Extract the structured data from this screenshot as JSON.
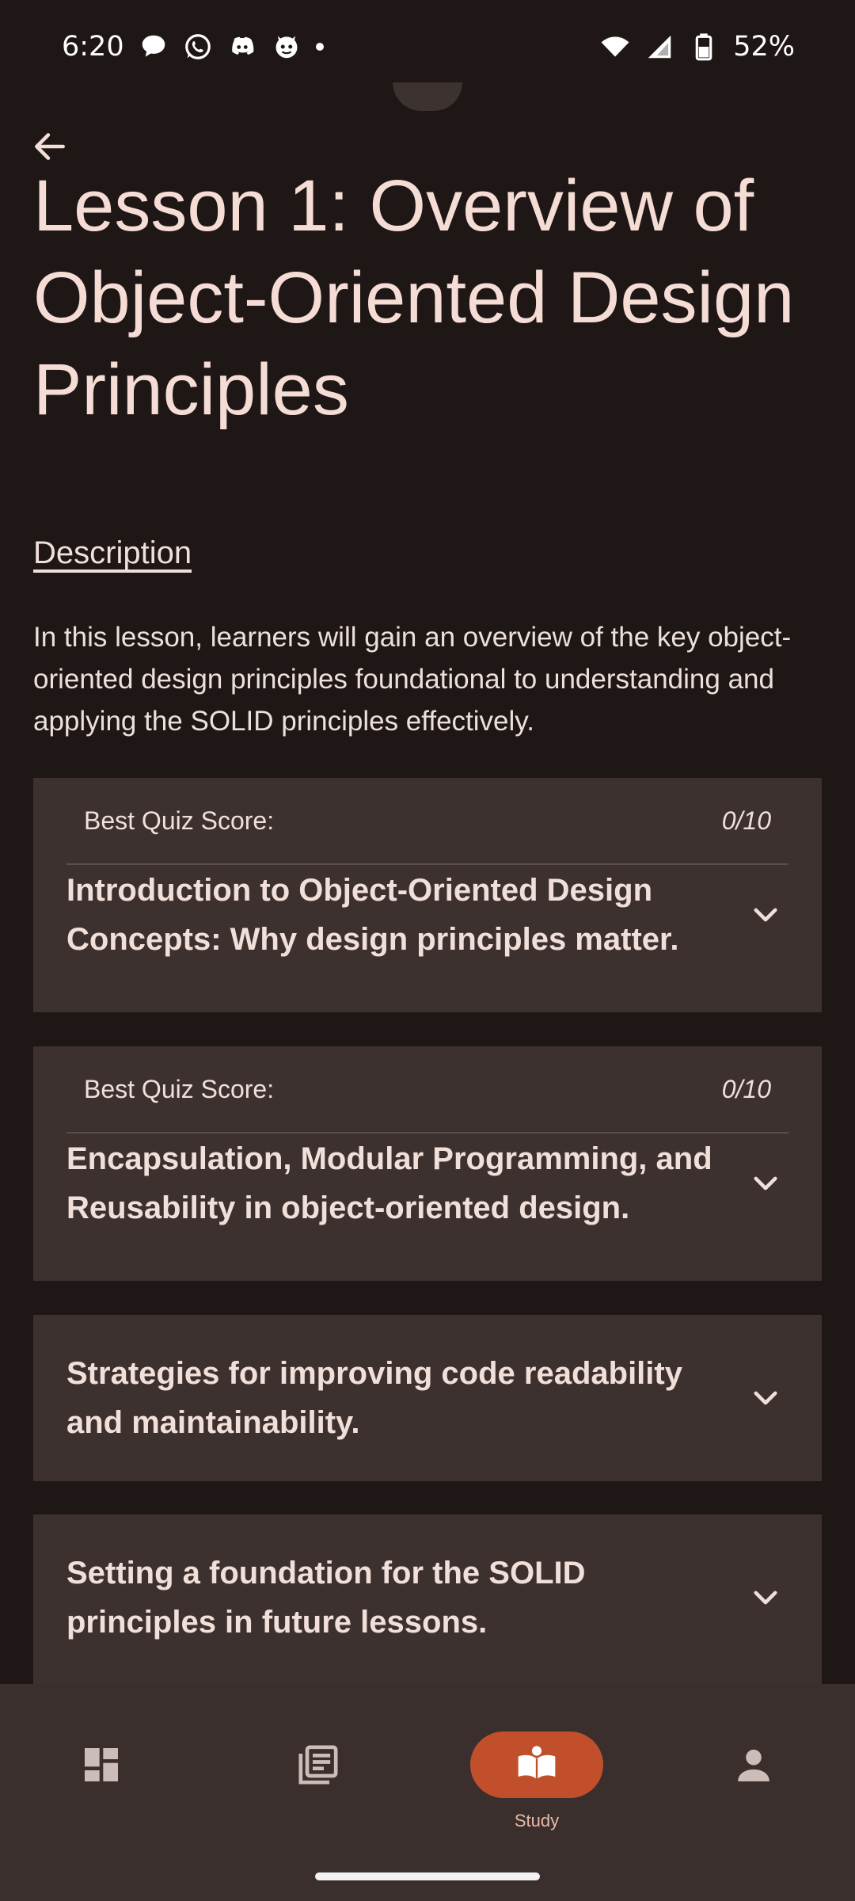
{
  "status_bar": {
    "time": "6:20",
    "notification_icons": [
      "chat-bubble-icon",
      "whatsapp-icon",
      "discord-icon",
      "github-icon",
      "more-dot-icon"
    ],
    "battery": "52%"
  },
  "header": {
    "back_icon": "arrow-left-icon",
    "title": "Lesson 1: Overview of Object-Oriented Design Principles"
  },
  "description": {
    "heading": "Description",
    "text": "In this lesson, learners will gain an overview of the key object-oriented design principles foundational to understanding and applying the SOLID principles effectively."
  },
  "topics": [
    {
      "quiz_label": "Best Quiz Score:",
      "quiz_score": "0/10",
      "title": "Introduction to Object-Oriented Design Concepts: Why design principles matter."
    },
    {
      "quiz_label": "Best Quiz Score:",
      "quiz_score": "0/10",
      "title": "Encapsulation, Modular Programming, and Reusability in object-oriented design."
    },
    {
      "title": "Strategies for improving code readability and maintainability."
    },
    {
      "title": "Setting a foundation for the SOLID principles in future lessons."
    }
  ],
  "bottom_nav": {
    "items": [
      {
        "icon": "dashboard-icon",
        "label": ""
      },
      {
        "icon": "library-icon",
        "label": ""
      },
      {
        "icon": "study-book-icon",
        "label": "Study",
        "active": true
      },
      {
        "icon": "person-icon",
        "label": ""
      }
    ]
  },
  "colors": {
    "background": "#1e1716",
    "card": "#3d3130",
    "accent": "#c24f2c",
    "text": "#f1dfd9"
  }
}
